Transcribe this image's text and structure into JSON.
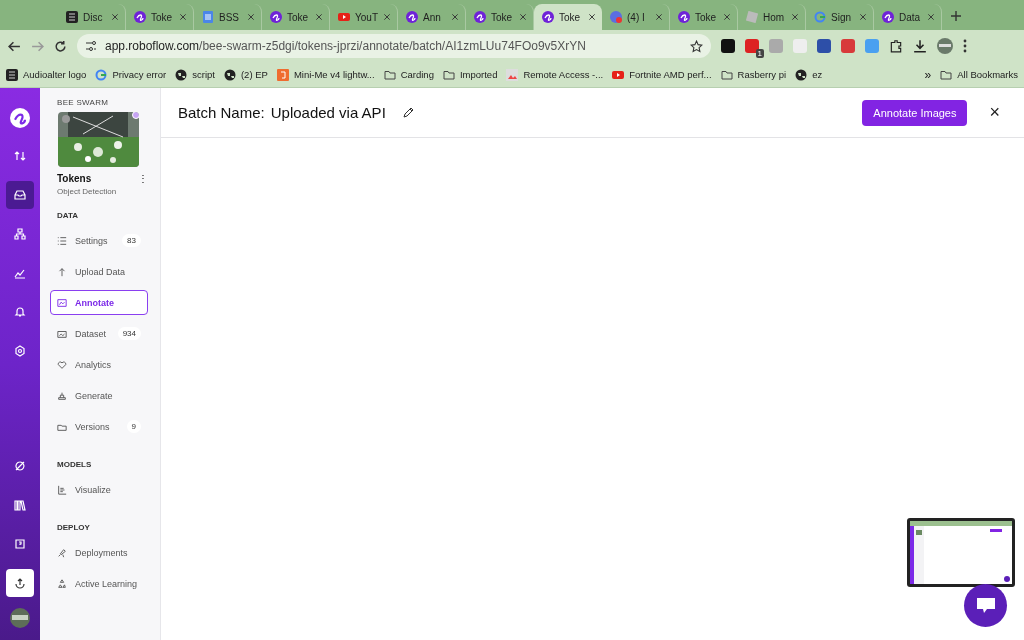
{
  "browser": {
    "tabs": [
      {
        "title": "Disc",
        "kind": "dark",
        "selected": false
      },
      {
        "title": "Toke",
        "kind": "roboflow",
        "selected": false
      },
      {
        "title": "BSS",
        "kind": "docs",
        "selected": false
      },
      {
        "title": "Toke",
        "kind": "roboflow",
        "selected": false
      },
      {
        "title": "YouT",
        "kind": "youtube",
        "selected": false
      },
      {
        "title": "Ann",
        "kind": "roboflow",
        "selected": false
      },
      {
        "title": "Toke",
        "kind": "roboflow",
        "selected": false
      },
      {
        "title": "Toke",
        "kind": "roboflow",
        "selected": true
      },
      {
        "title": "(4) I",
        "kind": "reddot",
        "selected": false
      },
      {
        "title": "Toke",
        "kind": "roboflow",
        "selected": false
      },
      {
        "title": "Hom",
        "kind": "game",
        "selected": false
      },
      {
        "title": "Sign",
        "kind": "google",
        "selected": false
      },
      {
        "title": "Data",
        "kind": "roboflow",
        "selected": false
      }
    ],
    "url_host": "app.roboflow.com",
    "url_path": "/bee-swarm-z5dgi/tokens-jprzi/annotate/batch/AI1zmLUu74FOo9v5XrYN",
    "extension_badge": "1",
    "bookmarks": [
      {
        "label": "Audioalter logo",
        "kind": "dark"
      },
      {
        "label": "Privacy error",
        "kind": "google"
      },
      {
        "label": "script",
        "kind": "globe"
      },
      {
        "label": "(2) EP",
        "kind": "globe"
      },
      {
        "label": "Mini-Me v4 lightw...",
        "kind": "orange"
      },
      {
        "label": "Carding",
        "kind": "folder"
      },
      {
        "label": "Imported",
        "kind": "folder"
      },
      {
        "label": "Remote Access -...",
        "kind": "remote"
      },
      {
        "label": "Fortnite AMD perf...",
        "kind": "youtube"
      },
      {
        "label": "Rasberry pi",
        "kind": "folder"
      },
      {
        "label": "ez",
        "kind": "globe"
      }
    ],
    "bookmarks_more": "»",
    "all_bookmarks": "All Bookmarks"
  },
  "rail": {
    "items": [
      {
        "selected": false
      },
      {
        "selected": true
      },
      {
        "selected": false
      },
      {
        "selected": false
      },
      {
        "selected": false
      },
      {
        "selected": false
      }
    ],
    "bottom_items": [
      {
        "selected": false
      },
      {
        "selected": false
      },
      {
        "selected": false
      },
      {
        "selected": true
      }
    ]
  },
  "sidebar": {
    "workspace": "BEE SWARM",
    "project_name": "Tokens",
    "project_menu": "⋮",
    "project_type": "Object Detection",
    "sections": [
      {
        "title": "DATA",
        "items": [
          {
            "label": "Settings",
            "badge": "83",
            "selected": false
          },
          {
            "label": "Upload Data",
            "selected": false
          },
          {
            "label": "Annotate",
            "selected": true
          },
          {
            "label": "Dataset",
            "badge": "934",
            "selected": false
          },
          {
            "label": "Analytics",
            "selected": false
          },
          {
            "label": "Generate",
            "selected": false
          },
          {
            "label": "Versions",
            "badge": "9",
            "selected": false
          }
        ]
      },
      {
        "title": "MODELS",
        "items": [
          {
            "label": "Visualize",
            "selected": false
          }
        ]
      },
      {
        "title": "DEPLOY",
        "items": [
          {
            "label": "Deployments",
            "selected": false
          },
          {
            "label": "Active Learning",
            "selected": false
          }
        ]
      }
    ]
  },
  "header": {
    "label": "Batch Name:",
    "batch_name": "Uploaded via API",
    "action": "Annotate Images",
    "close": "×"
  }
}
